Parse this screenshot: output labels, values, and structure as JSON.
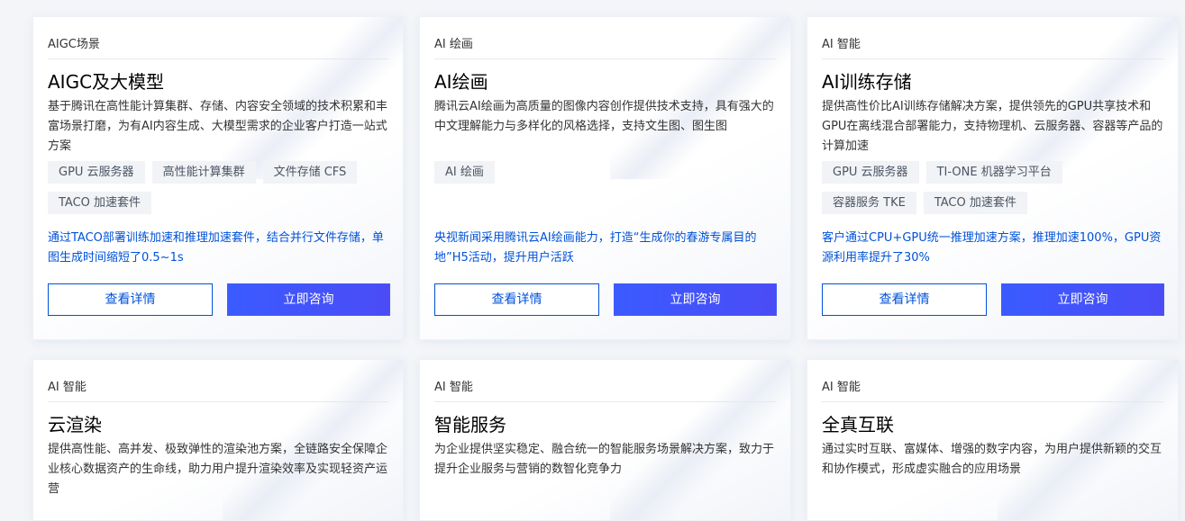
{
  "cards": [
    {
      "category": "AIGC场景",
      "title": "AIGC及大模型",
      "desc": "基于腾讯在高性能计算集群、存储、内容安全领域的技术积累和丰富场景打磨，为有AI内容生成、大模型需求的企业客户打造一站式方案",
      "tags": [
        "GPU 云服务器",
        "高性能计算集群",
        "文件存储 CFS",
        "TACO 加速套件"
      ],
      "highlight": "通过TACO部署训练加速和推理加速套件，结合并行文件存储，单图生成时间缩短了0.5~1s",
      "detail_label": "查看详情",
      "consult_label": "立即咨询"
    },
    {
      "category": "AI 绘画",
      "title": "AI绘画",
      "desc": "腾讯云AI绘画为高质量的图像内容创作提供技术支持，具有强大的中文理解能力与多样化的风格选择，支持文生图、图生图",
      "tags": [
        "AI 绘画"
      ],
      "highlight": "央视新闻采用腾讯云AI绘画能力，打造“生成你的春游专属目的地”H5活动，提升用户活跃",
      "detail_label": "查看详情",
      "consult_label": "立即咨询"
    },
    {
      "category": "AI 智能",
      "title": "AI训练存储",
      "desc": "提供高性价比AI训练存储解决方案，提供领先的GPU共享技术和GPU在离线混合部署能力，支持物理机、云服务器、容器等产品的计算加速",
      "tags": [
        "GPU 云服务器",
        "TI-ONE 机器学习平台",
        "容器服务 TKE",
        "TACO 加速套件"
      ],
      "highlight": "客户通过CPU+GPU统一推理加速方案，推理加速100%，GPU资源利用率提升了30%",
      "detail_label": "查看详情",
      "consult_label": "立即咨询"
    },
    {
      "category": "AI 智能",
      "title": "云渲染",
      "desc": "提供高性能、高并发、极致弹性的渲染池方案，全链路安全保障企业核心数据资产的生命线，助力用户提升渲染效率及实现轻资产运营"
    },
    {
      "category": "AI 智能",
      "title": "智能服务",
      "desc": "为企业提供坚实稳定、融合统一的智能服务场景解决方案，致力于提升企业服务与营销的数智化竞争力"
    },
    {
      "category": "AI 智能",
      "title": "全真互联",
      "desc": "通过实时互联、富媒体、增强的数字内容，为用户提供新颖的交互和协作模式，形成虚实融合的应用场景"
    }
  ]
}
